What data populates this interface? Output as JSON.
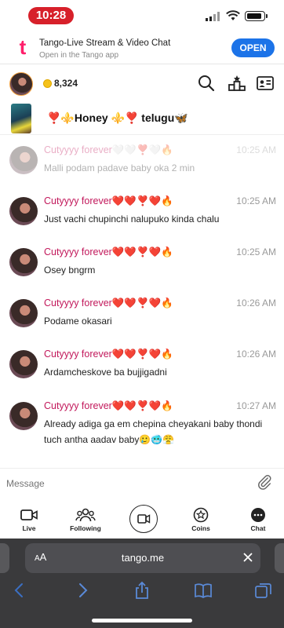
{
  "status_bar": {
    "time": "10:28"
  },
  "banner": {
    "title": "Tango-Live Stream & Video Chat",
    "subtitle": "Open in the Tango app",
    "open_label": "OPEN",
    "logo_letter": "t"
  },
  "header": {
    "coins": "8,324"
  },
  "stream": {
    "title": "❣️⚜️Honey ⚜️❣️ telugu🦋"
  },
  "messages": [
    {
      "name": "Cutyyyy forever🤍🤍❣️🤍🔥",
      "time": "10:25 AM",
      "text": "Malli podam padave baby oka 2 min",
      "faded": true
    },
    {
      "name": "Cutyyyy forever❤️❤️❣️❤️🔥",
      "time": "10:25 AM",
      "text": "Just vachi chupinchi nalupuko kinda chalu"
    },
    {
      "name": "Cutyyyy forever❤️❤️❣️❤️🔥",
      "time": "10:25 AM",
      "text": "Osey bngrm"
    },
    {
      "name": "Cutyyyy forever❤️❤️❣️❤️🔥",
      "time": "10:26 AM",
      "text": "Podame okasari"
    },
    {
      "name": "Cutyyyy forever❤️❤️❣️❤️🔥",
      "time": "10:26 AM",
      "text": "Ardamcheskove ba bujjigadni"
    },
    {
      "name": "Cutyyyy forever❤️❤️❣️❤️🔥",
      "time": "10:27 AM",
      "text": "Already adiga ga em chepina cheyakani baby thondi tuch antha aadav baby🥲🥶😤"
    }
  ],
  "composer": {
    "placeholder": "Message"
  },
  "nav": {
    "live": "Live",
    "following": "Following",
    "coins": "Coins",
    "chat": "Chat"
  },
  "safari": {
    "aa_small": "A",
    "aa_large": "A",
    "url": "tango.me"
  },
  "colors": {
    "accent": "#1c73e8",
    "brand": "#ff1f6b",
    "username": "#c2185b",
    "recording": "#d7202a"
  }
}
